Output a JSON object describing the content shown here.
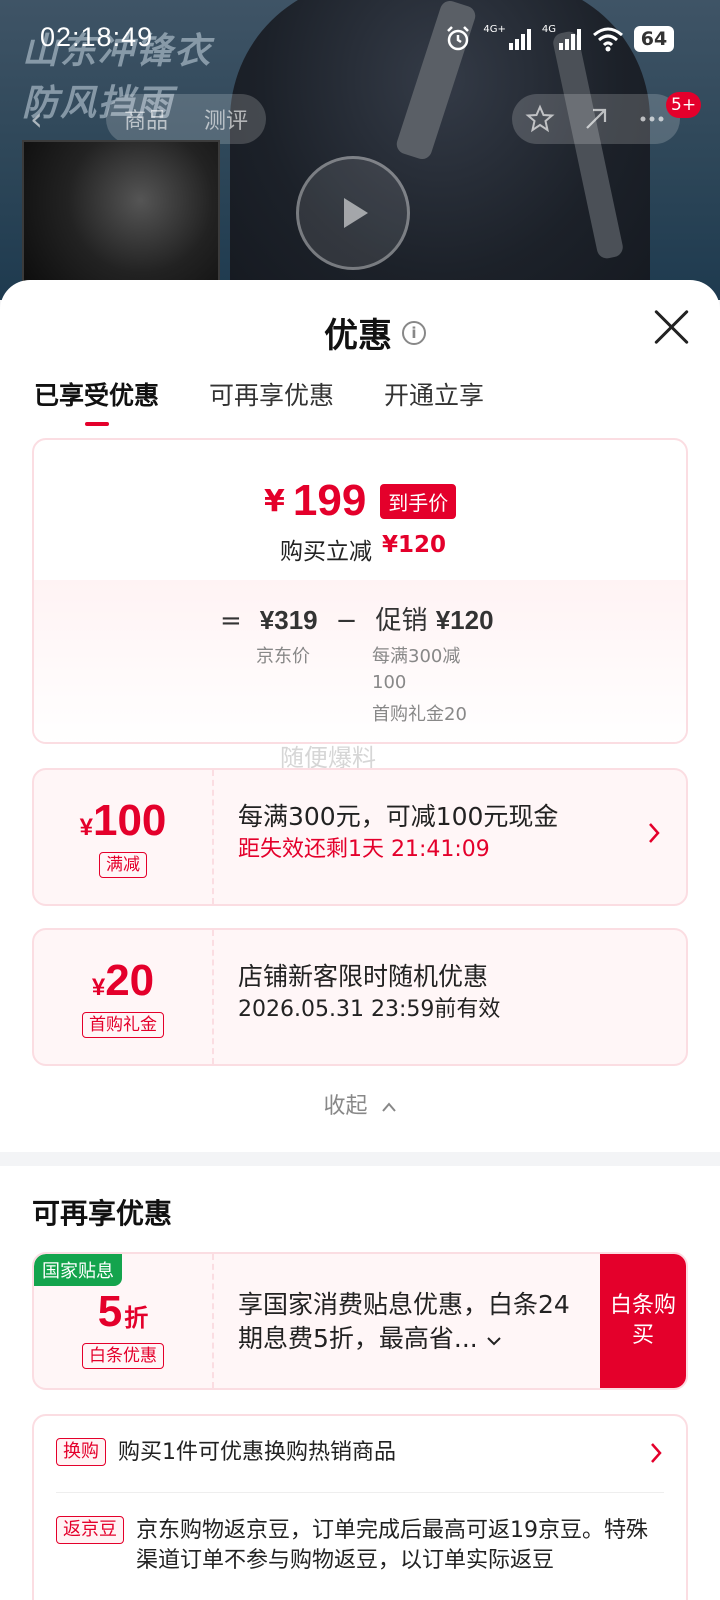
{
  "status_bar": {
    "time": "02:18:49",
    "network1": "4G+",
    "network2": "4G",
    "battery": "64"
  },
  "backdrop": {
    "promo_line1": "山东冲锋衣",
    "promo_line2": "防风挡雨",
    "tabs": [
      "商品",
      "测评"
    ],
    "badge": "5+"
  },
  "sheet": {
    "title": "优惠",
    "tabs": [
      "已享受优惠",
      "可再享优惠",
      "开通立享"
    ],
    "active_tab": 0
  },
  "summary": {
    "currency": "¥",
    "final_price": "199",
    "final_tag": "到手价",
    "cut_label": "购买立减",
    "cut_value": "¥120",
    "equals": "=",
    "jd_price": "¥319",
    "minus": "−",
    "promo_label": "促销",
    "promo_value": "¥120",
    "jd_price_label": "京东价",
    "promo_detail1": "每满300减100",
    "promo_detail2": "首购礼金20"
  },
  "watermark": "随便爆料",
  "coupons": [
    {
      "yen": "¥",
      "amount": "100",
      "tag": "满减",
      "title": "每满300元，可减100元现金",
      "sub": "距失效还剩1天 21:41:09"
    },
    {
      "yen": "¥",
      "amount": "20",
      "tag": "首购礼金",
      "title": "店铺新客限时随机优惠",
      "sub": "2026.05.31 23:59前有效"
    }
  ],
  "collapse_label": "收起",
  "more_section": {
    "title": "可再享优惠",
    "gov": {
      "badge": "国家贴息",
      "amount": "5",
      "unit": "折",
      "tag": "白条优惠",
      "title": "享国家消费贴息优惠，白条24期息费5折，最高省...",
      "button": "白条购买"
    },
    "rows": [
      {
        "tag": "换购",
        "text": "购买1件可优惠换购热销商品"
      },
      {
        "tag": "返京豆",
        "text": "京东购物返京豆，订单完成后最高可返19京豆。特殊渠道订单不参与购物返豆，以订单实际返豆"
      }
    ]
  },
  "colors": {
    "accent": "#e4002b",
    "gov_green": "#14a44d",
    "card_border": "#fbdde2",
    "card_bg": "#fff6f7"
  }
}
